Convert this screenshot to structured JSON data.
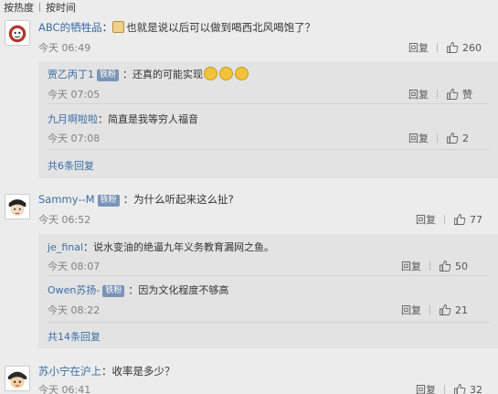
{
  "sort_bar": {
    "hot_label": "按热度",
    "time_label": "按时间"
  },
  "comments": [
    {
      "user": "ABC的牺牲品",
      "colon": "：",
      "text": "也就是说以后可以做到喝西北风喝饱了？",
      "time": "今天 06:49",
      "reply_label": "回复",
      "likes": "260",
      "avatar_icon": "cartoon-mascot-avatar",
      "replies": [
        {
          "user": "贾乙丙丁1",
          "badge": "铁粉",
          "colon": "：",
          "text": "还真的可能实现",
          "time": "今天 07:05",
          "reply_label": "回复",
          "likes": "赞",
          "emoji_icon": "grinning-emoji"
        },
        {
          "user": "九月啊啦啦",
          "colon": "：",
          "text": "简直是我等穷人福音",
          "time": "今天 07:08",
          "reply_label": "回复",
          "likes": "2"
        }
      ],
      "more_replies": "共6条回复"
    },
    {
      "user": "Sammy--M",
      "badge": "铁粉",
      "colon": "：",
      "text": "为什么听起来这么扯?",
      "time": "今天 06:52",
      "reply_label": "回复",
      "likes": "77",
      "avatar_icon": "cartoon-face-avatar",
      "replies": [
        {
          "user": "je_final",
          "colon": "：",
          "text": "说水变油的绝逼九年义务教育漏网之鱼。",
          "time": "今天 08:07",
          "reply_label": "回复",
          "likes": "50"
        },
        {
          "user": "Owen苏扬-",
          "badge": "铁粉",
          "colon": "：",
          "text": "因为文化程度不够高",
          "time": "今天 08:22",
          "reply_label": "回复",
          "likes": "21"
        }
      ],
      "more_replies": "共14条回复"
    },
    {
      "user": "苏小宁在沪上",
      "colon": "：",
      "text": "收率是多少？",
      "time": "今天 06:41",
      "reply_label": "回复",
      "likes": "32",
      "avatar_icon": "anime-character-avatar"
    }
  ],
  "colors": {
    "link": "#3a6ea5",
    "badge": "#7a94b6",
    "background": "#ececec",
    "sub_box": "#e3e3e3"
  }
}
